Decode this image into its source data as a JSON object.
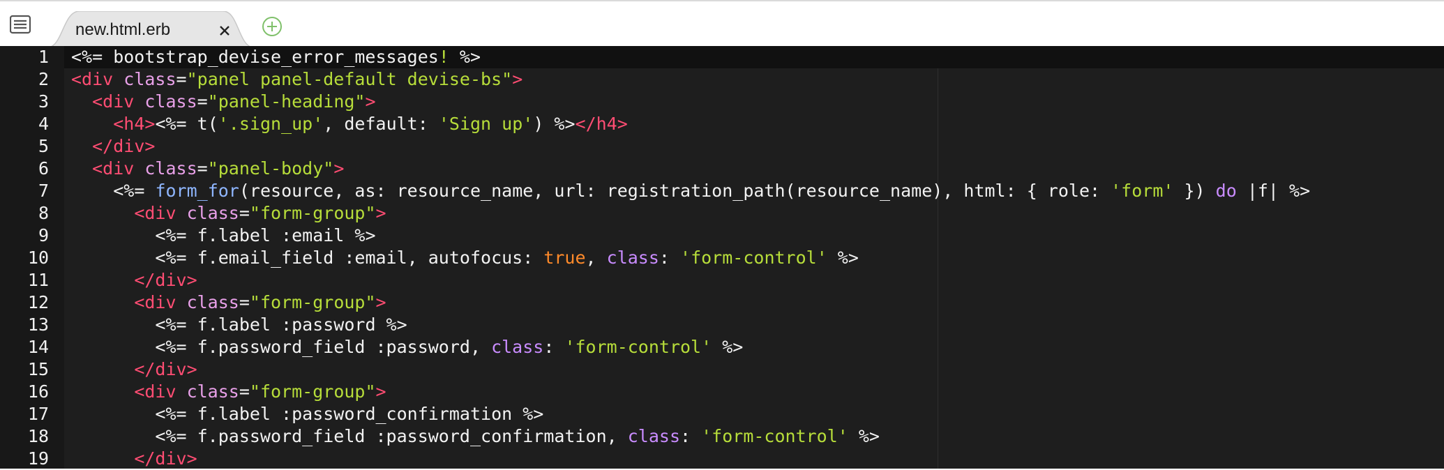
{
  "tabs": [
    {
      "label": "new.html.erb",
      "active": true
    }
  ],
  "icons": {
    "menu": "list-menu-icon",
    "close": "close-icon",
    "add": "add-tab-icon"
  },
  "colors": {
    "background": "#1e1e1e",
    "gutter": "#181818",
    "tag": "#ff4d73",
    "string": "#b7dd3a",
    "attribute": "#e8a0e8",
    "method": "#8fb6ff",
    "keyword": "#c98cff",
    "boolean": "#ff8a2a",
    "add_icon": "#7fc06a"
  },
  "editor": {
    "current_line": 1,
    "lines": [
      {
        "n": "1",
        "indent": "",
        "tokens": [
          [
            "erb",
            "<%= bootstrap_devise_error_messages"
          ],
          [
            "str",
            "!"
          ],
          [
            "erb",
            " %>"
          ]
        ]
      },
      {
        "n": "2",
        "indent": "",
        "tokens": [
          [
            "tag",
            "<div "
          ],
          [
            "attr",
            "class"
          ],
          [
            "plain",
            "="
          ],
          [
            "str",
            "\"panel panel-default devise-bs\""
          ],
          [
            "tag",
            ">"
          ]
        ]
      },
      {
        "n": "3",
        "indent": "  ",
        "tokens": [
          [
            "tag",
            "<div "
          ],
          [
            "attr",
            "class"
          ],
          [
            "plain",
            "="
          ],
          [
            "str",
            "\"panel-heading\""
          ],
          [
            "tag",
            ">"
          ]
        ]
      },
      {
        "n": "4",
        "indent": "    ",
        "tokens": [
          [
            "tag",
            "<h4>"
          ],
          [
            "erb",
            "<%= t("
          ],
          [
            "str",
            "'.sign_up'"
          ],
          [
            "plain",
            ", default: "
          ],
          [
            "str",
            "'Sign up'"
          ],
          [
            "plain",
            ") %>"
          ],
          [
            "tag",
            "</h4>"
          ]
        ]
      },
      {
        "n": "5",
        "indent": "  ",
        "tokens": [
          [
            "tag",
            "</div>"
          ]
        ]
      },
      {
        "n": "6",
        "indent": "  ",
        "tokens": [
          [
            "tag",
            "<div "
          ],
          [
            "attr",
            "class"
          ],
          [
            "plain",
            "="
          ],
          [
            "str",
            "\"panel-body\""
          ],
          [
            "tag",
            ">"
          ]
        ]
      },
      {
        "n": "7",
        "indent": "    ",
        "tokens": [
          [
            "erb",
            "<%= "
          ],
          [
            "method",
            "form_for"
          ],
          [
            "plain",
            "(resource, as: resource_name, url: registration_path(resource_name), html: { role: "
          ],
          [
            "str",
            "'form'"
          ],
          [
            "plain",
            " }) "
          ],
          [
            "kw",
            "do"
          ],
          [
            "plain",
            " |f| %>"
          ]
        ]
      },
      {
        "n": "8",
        "indent": "      ",
        "tokens": [
          [
            "tag",
            "<div "
          ],
          [
            "attr",
            "class"
          ],
          [
            "plain",
            "="
          ],
          [
            "str",
            "\"form-group\""
          ],
          [
            "tag",
            ">"
          ]
        ]
      },
      {
        "n": "9",
        "indent": "        ",
        "tokens": [
          [
            "erb",
            "<%= f.label :email %>"
          ]
        ]
      },
      {
        "n": "10",
        "indent": "        ",
        "tokens": [
          [
            "erb",
            "<%= f.email_field :email, autofocus: "
          ],
          [
            "bool",
            "true"
          ],
          [
            "plain",
            ", "
          ],
          [
            "kw",
            "class"
          ],
          [
            "plain",
            ": "
          ],
          [
            "str",
            "'form-control'"
          ],
          [
            "plain",
            " %>"
          ]
        ]
      },
      {
        "n": "11",
        "indent": "      ",
        "tokens": [
          [
            "tag",
            "</div>"
          ]
        ]
      },
      {
        "n": "12",
        "indent": "      ",
        "tokens": [
          [
            "tag",
            "<div "
          ],
          [
            "attr",
            "class"
          ],
          [
            "plain",
            "="
          ],
          [
            "str",
            "\"form-group\""
          ],
          [
            "tag",
            ">"
          ]
        ]
      },
      {
        "n": "13",
        "indent": "        ",
        "tokens": [
          [
            "erb",
            "<%= f.label :password %>"
          ]
        ]
      },
      {
        "n": "14",
        "indent": "        ",
        "tokens": [
          [
            "erb",
            "<%= f.password_field :password, "
          ],
          [
            "kw",
            "class"
          ],
          [
            "plain",
            ": "
          ],
          [
            "str",
            "'form-control'"
          ],
          [
            "plain",
            " %>"
          ]
        ]
      },
      {
        "n": "15",
        "indent": "      ",
        "tokens": [
          [
            "tag",
            "</div>"
          ]
        ]
      },
      {
        "n": "16",
        "indent": "      ",
        "tokens": [
          [
            "tag",
            "<div "
          ],
          [
            "attr",
            "class"
          ],
          [
            "plain",
            "="
          ],
          [
            "str",
            "\"form-group\""
          ],
          [
            "tag",
            ">"
          ]
        ]
      },
      {
        "n": "17",
        "indent": "        ",
        "tokens": [
          [
            "erb",
            "<%= f.label :password_confirmation %>"
          ]
        ]
      },
      {
        "n": "18",
        "indent": "        ",
        "tokens": [
          [
            "erb",
            "<%= f.password_field :password_confirmation, "
          ],
          [
            "kw",
            "class"
          ],
          [
            "plain",
            ": "
          ],
          [
            "str",
            "'form-control'"
          ],
          [
            "plain",
            " %>"
          ]
        ]
      },
      {
        "n": "19",
        "indent": "      ",
        "tokens": [
          [
            "tag",
            "</div>"
          ]
        ]
      }
    ]
  }
}
